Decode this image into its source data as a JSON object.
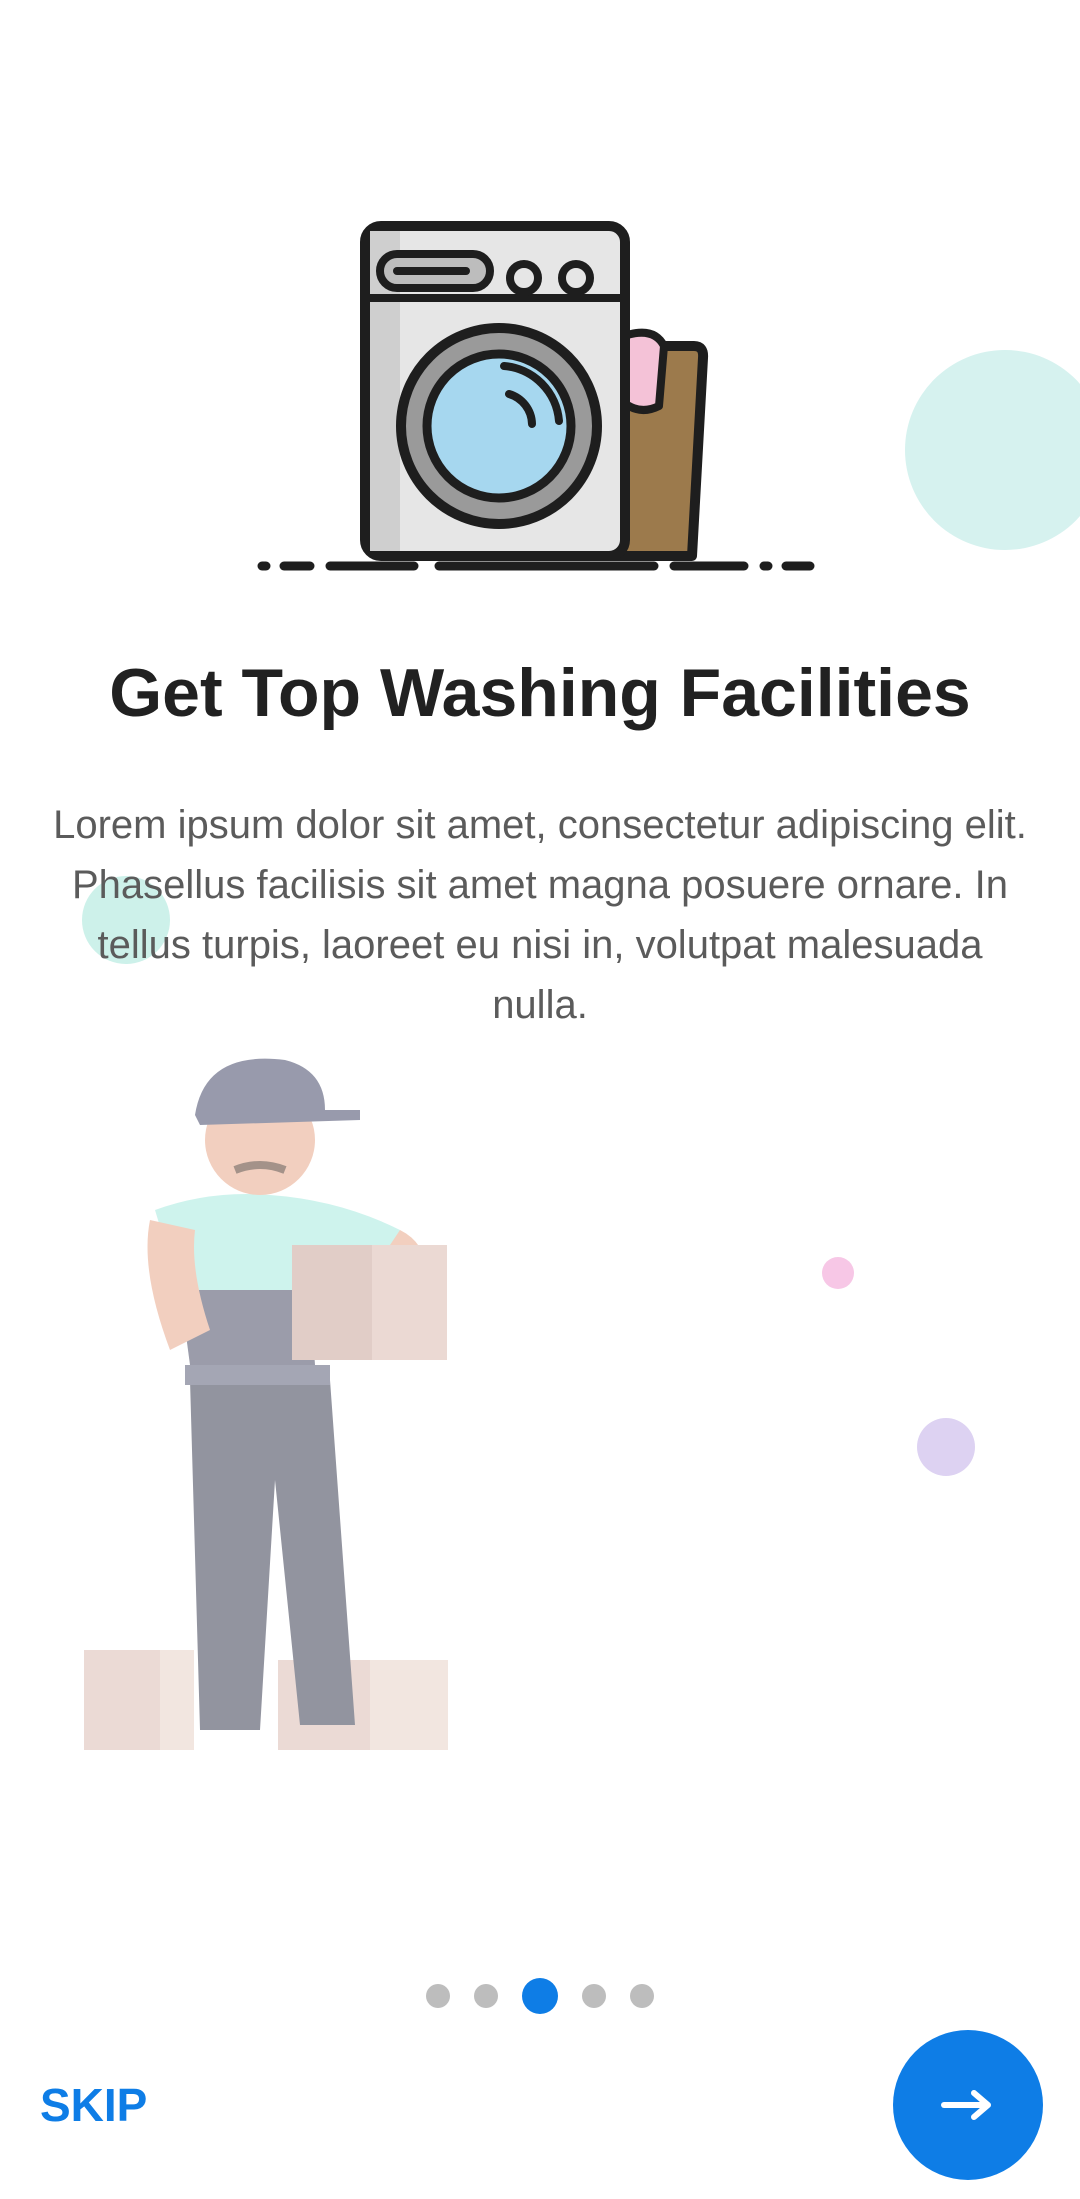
{
  "onboarding": {
    "title": "Get Top Washing Facilities",
    "description": "Lorem ipsum dolor sit amet, consectetur adipiscing elit. Phasellus facilisis sit amet magna posuere ornare. In tellus turpis, laoreet eu nisi in, volutpat malesuada nulla.",
    "skip_label": "SKIP",
    "next_icon": "arrow-right-icon",
    "pager": {
      "total": 5,
      "current": 3
    }
  },
  "colors": {
    "accent": "#0e7de6",
    "title": "#212121",
    "body_text": "#5b5b5b",
    "dot_inactive": "#bdbdbd"
  }
}
